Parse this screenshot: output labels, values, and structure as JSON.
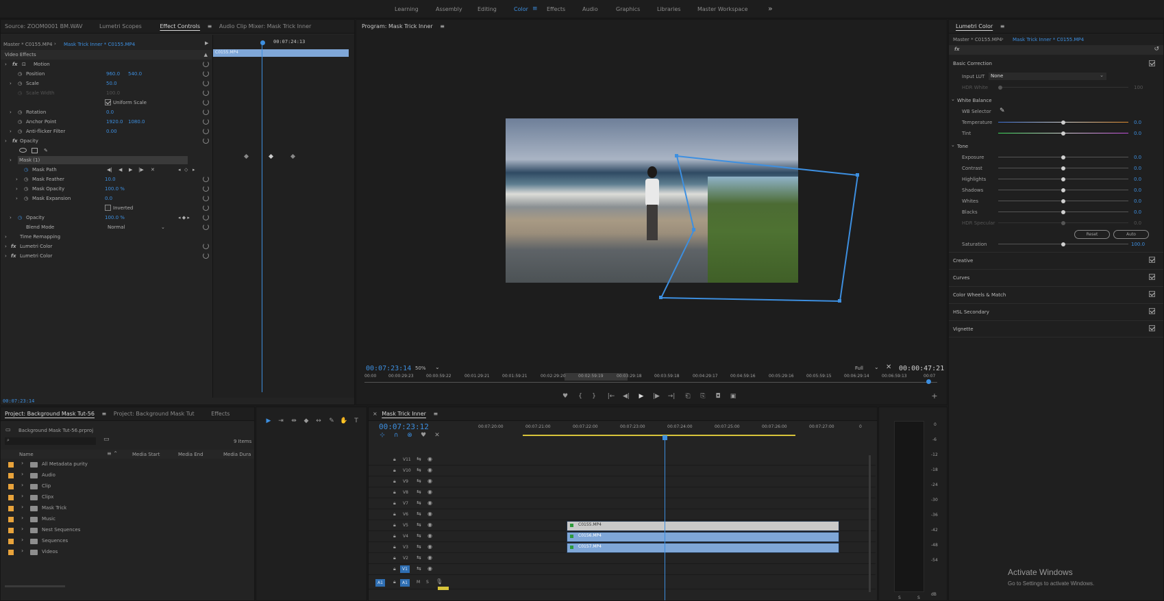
{
  "workspaces": {
    "items": [
      "Learning",
      "Assembly",
      "Editing",
      "Color",
      "Effects",
      "Audio",
      "Graphics",
      "Libraries",
      "Master Workspace"
    ],
    "active": "Color",
    "more": "»"
  },
  "source_panel": {
    "tabs": [
      "Source: ZOOM0001 BM.WAV",
      "Lumetri Scopes",
      "Effect Controls",
      "Audio Clip Mixer: Mask Trick Inner"
    ],
    "master_label": "Master * C0155.MP4",
    "clip_label": "Mask Trick Inner * C0155.MP4",
    "ruler_time": "00:07:24:13",
    "clip_bar_label": "C0155.MP4",
    "video_effects": "Video Effects",
    "rows": {
      "motion": "Motion",
      "position": "Position",
      "position_x": "960.0",
      "position_y": "540.0",
      "scale": "Scale",
      "scale_val": "50.0",
      "scale_width": "Scale Width",
      "scale_width_val": "100.0",
      "uniform_scale": "Uniform Scale",
      "rotation": "Rotation",
      "rotation_val": "0.0",
      "anchor": "Anchor Point",
      "anchor_x": "1920.0",
      "anchor_y": "1080.0",
      "antiflicker": "Anti-flicker Filter",
      "antiflicker_val": "0.00",
      "opacity": "Opacity",
      "mask": "Mask (1)",
      "mask_path": "Mask Path",
      "mask_feather": "Mask Feather",
      "mask_feather_val": "10.0",
      "mask_opacity": "Mask Opacity",
      "mask_opacity_val": "100.0 %",
      "mask_expansion": "Mask Expansion",
      "mask_expansion_val": "0.0",
      "inverted": "Inverted",
      "opacity2": "Opacity",
      "opacity2_val": "100.0 %",
      "blend_mode": "Blend Mode",
      "blend_mode_val": "Normal",
      "time_remap": "Time Remapping",
      "lumetri1": "Lumetri Color",
      "lumetri2": "Lumetri Color"
    },
    "footer_time": "00:07:23:14"
  },
  "program": {
    "title": "Program: Mask Trick Inner",
    "timecode": "00:07:23:14",
    "zoom": "50%",
    "quality": "Full",
    "duration": "00:47:21",
    "duration_prefix": "00:",
    "ruler": [
      "00:00",
      "00:00:29:23",
      "00:00:59:22",
      "00:01:29:21",
      "00:01:59:21",
      "00:02:29:20",
      "00:02:59:19",
      "00:03:29:18",
      "00:03:59:18",
      "00:04:29:17",
      "00:04:59:16",
      "00:05:29:16",
      "00:05:59:15",
      "00:06:29:14",
      "00:06:59:13",
      "00:07"
    ]
  },
  "lumetri": {
    "title": "Lumetri Color",
    "master_label": "Master * C0155.MP4",
    "clip_label": "Mask Trick Inner * C0155.MP4",
    "fx": "fx",
    "basic": "Basic Correction",
    "input_lut": "Input LUT",
    "input_lut_val": "None",
    "hdr_white": "HDR White",
    "hdr_white_val": "100",
    "wb": "White Balance",
    "wb_selector": "WB Selector",
    "temperature": "Temperature",
    "temperature_val": "0.0",
    "tint": "Tint",
    "tint_val": "0.0",
    "tone": "Tone",
    "exposure": "Exposure",
    "exposure_val": "0.0",
    "contrast": "Contrast",
    "contrast_val": "0.0",
    "highlights": "Highlights",
    "highlights_val": "0.0",
    "shadows": "Shadows",
    "shadows_val": "0.0",
    "whites": "Whites",
    "whites_val": "0.0",
    "blacks": "Blacks",
    "blacks_val": "0.0",
    "hdr_specular": "HDR Specular",
    "hdr_specular_val": "0.0",
    "reset": "Reset",
    "auto": "Auto",
    "saturation": "Saturation",
    "saturation_val": "100.0",
    "sections": [
      "Creative",
      "Curves",
      "Color Wheels & Match",
      "HSL Secondary",
      "Vignette"
    ]
  },
  "project": {
    "tabs": [
      "Project: Background Mask Tut-56",
      "Project: Background Mask Tut",
      "Effects"
    ],
    "file": "Background Mask Tut-56.prproj",
    "items_count": "9 Items",
    "columns": [
      "Name",
      "Media Start",
      "Media End",
      "Media Dura"
    ],
    "bins": [
      "All Metadata purity",
      "Audio",
      "Clip",
      "Clipx",
      "Mask Trick",
      "Music",
      "Nest Sequences",
      "Sequences",
      "Videos"
    ]
  },
  "timeline": {
    "title": "Mask Trick Inner",
    "timecode": "00:07:23:12",
    "ruler": [
      "00:07:20:00",
      "00:07:21:00",
      "00:07:22:00",
      "00:07:23:00",
      "00:07:24:00",
      "00:07:25:00",
      "00:07:26:00",
      "00:07:27:00",
      "0"
    ],
    "tracks": [
      "V11",
      "V10",
      "V9",
      "V8",
      "V7",
      "V6",
      "V5",
      "V4",
      "V3",
      "V2",
      "V1",
      "A1"
    ],
    "clips": [
      "C0155.MP4",
      "C0156.MP4",
      "C0157.MP4"
    ],
    "a1_src": "A1",
    "a1_m": "M",
    "a1_s": "S"
  },
  "meter": {
    "scale": [
      "0",
      "-6",
      "-12",
      "-18",
      "-24",
      "-30",
      "-36",
      "-42",
      "-48",
      "-54",
      "dB"
    ],
    "s1": "S",
    "s2": "S"
  },
  "watermark": {
    "title": "Activate Windows",
    "subtitle": "Go to Settings to activate Windows."
  },
  "colors": {
    "accent": "#3d8fe0",
    "clip_blue": "#7fa7d8",
    "clip_white": "#c9c9c9",
    "label_orange": "#e8a33b",
    "mask": "#3d8fe0"
  }
}
